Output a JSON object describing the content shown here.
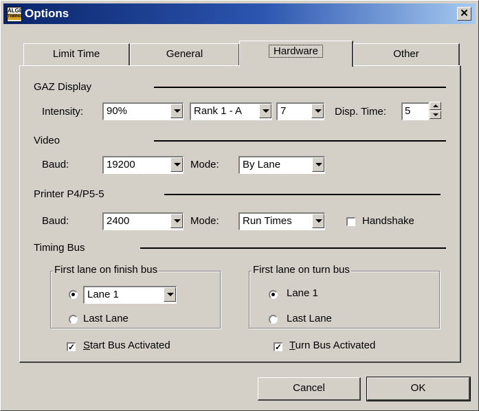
{
  "window": {
    "title": "Options",
    "app_icon_top": "ALGE",
    "app_icon_bottom": "TIMING",
    "close_glyph": "✕"
  },
  "tabs": [
    {
      "label": "Limit Time",
      "active": false
    },
    {
      "label": "General",
      "active": false
    },
    {
      "label": "Hardware",
      "active": true
    },
    {
      "label": "Other",
      "active": false
    }
  ],
  "gaz": {
    "section": "GAZ Display",
    "intensity_label": "Intensity:",
    "intensity_value": "90%",
    "rank_value": "Rank 1 - A",
    "digits_value": "7",
    "disp_time_label": "Disp. Time:",
    "disp_time_value": "5"
  },
  "video": {
    "section": "Video",
    "baud_label": "Baud:",
    "baud_value": "19200",
    "mode_label": "Mode:",
    "mode_value": "By Lane"
  },
  "printer": {
    "section": "Printer P4/P5-5",
    "baud_label": "Baud:",
    "baud_value": "2400",
    "mode_label": "Mode:",
    "mode_value": "Run Times",
    "handshake_label": "Handshake",
    "handshake_checked": false
  },
  "timing_bus": {
    "section": "Timing Bus",
    "finish": {
      "group_title": "First lane on finish bus",
      "lane_value": "Lane 1",
      "last_lane_label": "Last Lane",
      "selected": "lane"
    },
    "turn": {
      "group_title": "First lane on turn bus",
      "lane1_label": "Lane 1",
      "last_lane_label": "Last Lane",
      "selected": "lane1"
    },
    "start_bus": {
      "mnemonic": "S",
      "rest": "tart Bus Activated",
      "checked": true
    },
    "turn_bus": {
      "mnemonic": "T",
      "rest": "urn Bus Activated",
      "checked": true
    }
  },
  "buttons": {
    "cancel": "Cancel",
    "ok": "OK"
  },
  "colors": {
    "face": "#d4d0c8",
    "title_start": "#0a246a",
    "title_end": "#a6caf0"
  }
}
